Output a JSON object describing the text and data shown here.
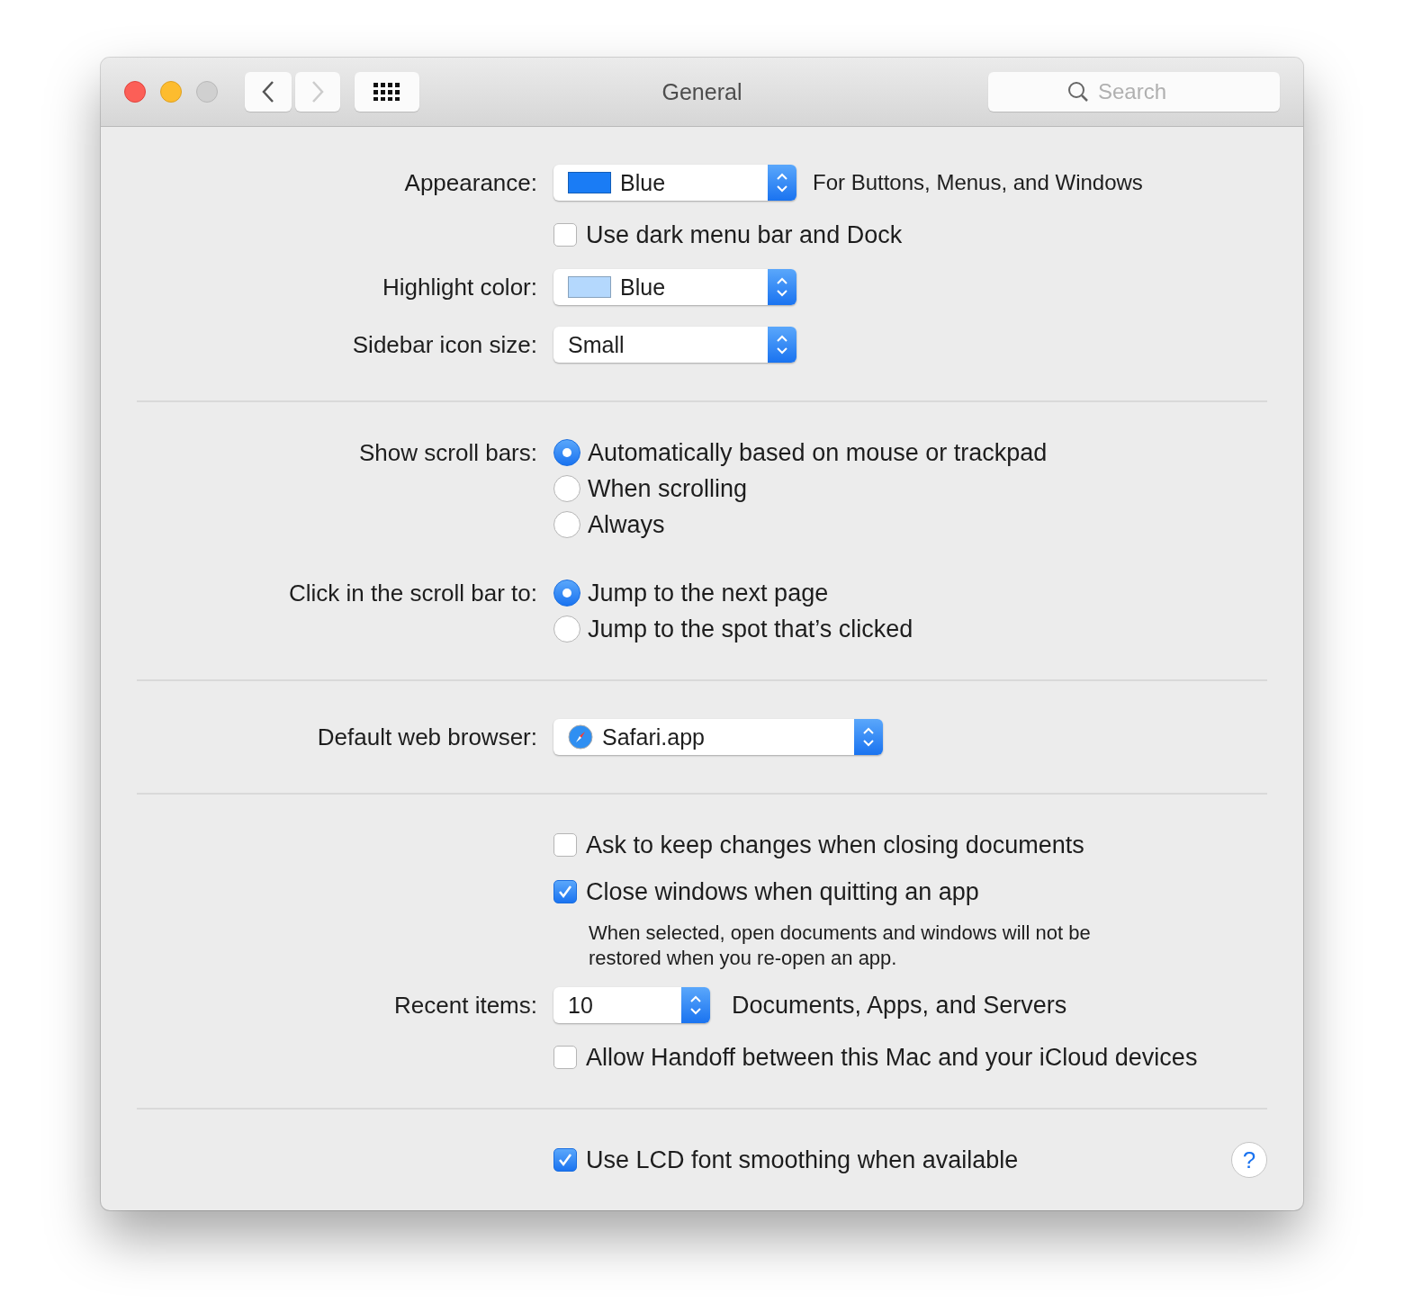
{
  "window": {
    "title": "General",
    "search": {
      "placeholder": "Search"
    }
  },
  "sections": [
    {
      "rows": [
        {
          "kind": "popup",
          "label": "Appearance:",
          "value": "Blue",
          "color": "#1a7cf5",
          "suffix": "For Buttons, Menus, and Windows"
        },
        {
          "kind": "checkbox",
          "text": "Use dark menu bar and Dock",
          "checked": false
        },
        {
          "kind": "popup",
          "label": "Highlight color:",
          "value": "Blue",
          "color": "#b4d8fd"
        },
        {
          "kind": "popup",
          "label": "Sidebar icon size:",
          "value": "Small"
        }
      ]
    },
    {
      "rows": [
        {
          "kind": "radios",
          "label": "Show scroll bars:",
          "options": [
            {
              "text": "Automatically based on mouse or trackpad",
              "selected": true
            },
            {
              "text": "When scrolling",
              "selected": false
            },
            {
              "text": "Always",
              "selected": false
            }
          ]
        },
        {
          "kind": "radios",
          "label": "Click in the scroll bar to:",
          "options": [
            {
              "text": "Jump to the next page",
              "selected": true
            },
            {
              "text": "Jump to the spot that’s clicked",
              "selected": false
            }
          ]
        }
      ]
    },
    {
      "rows": [
        {
          "kind": "browser_popup",
          "label": "Default web browser:",
          "value": "Safari.app"
        }
      ]
    },
    {
      "rows": [
        {
          "kind": "checkbox",
          "text": "Ask to keep changes when closing documents",
          "checked": false
        },
        {
          "kind": "checkbox",
          "text": "Close windows when quitting an app",
          "checked": true
        },
        {
          "kind": "note",
          "text": "When selected, open documents and windows will not be restored when you re-open an app."
        },
        {
          "kind": "count_popup",
          "label": "Recent items:",
          "value": "10",
          "suffix": "Documents, Apps, and Servers"
        },
        {
          "kind": "checkbox",
          "text": "Allow Handoff between this Mac and your iCloud devices",
          "checked": false
        }
      ]
    },
    {
      "rows": [
        {
          "kind": "checkbox",
          "text": "Use LCD font smoothing when available",
          "checked": true
        }
      ]
    }
  ],
  "help_button": {
    "label": "?"
  }
}
